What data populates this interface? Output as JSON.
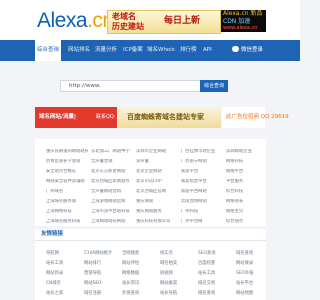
{
  "header": {
    "logo_main": "Alexa",
    "logo_tld": ".cn",
    "promo1": {
      "line1": "老域名",
      "line2": "历史建站",
      "right": "每日上新"
    },
    "promo2": {
      "line1": "Alexa.cn 新品",
      "line2": "CDN 加速",
      "line3": "www.alexa.cn"
    }
  },
  "nav": {
    "items": [
      "综合查询",
      "网站排名",
      "流量分析",
      "ICP备案",
      "域名Whois",
      "排行榜",
      "API"
    ],
    "login": "微信登录"
  },
  "search": {
    "value": "http://www.",
    "button": "综合查询"
  },
  "ads": {
    "red_left": "域名网站/流量|",
    "red_right": "联系QQ: 305...",
    "gold": "百度蜘蛛寄域名建站专家",
    "white": "此广告位招商 QQ 29619"
  },
  "panel": {
    "col1": [
      "重庆长期夜间网站站长",
      "西青区站长学会站",
      "安全站点合格证",
      "网站安全软件及辅助",
      "广州域名",
      "上海域名服务站",
      "上海网络科技",
      "上海域名服务科技"
    ],
    "col2": [
      "东北加工厂网站中小",
      "全声量营销",
      "北京东方新星网站",
      "北京西城区新闻站点",
      "全声量网站营销",
      "上海游戏网站官网",
      "上海市游平台站科技",
      "上海网站站长网站"
    ],
    "col3": [
      "深圳市企业网站",
      "深声量",
      "北京企业网站",
      "北京市店CRP",
      "北京西城区官网",
      "重庆网站",
      "重庆网站服务",
      "重庆科技有限公司"
    ],
    "col4": [
      "广西桂林市站企业",
      "广西南宁网站",
      "家居平台",
      "家居帮营平台",
      "家居平台网站",
      "云南昆明网站",
      "广州科技",
      "广州平台网"
    ],
    "col5": [
      "深圳网站企业",
      "网络科技",
      "网络平台",
      "平台服务",
      "综合科技",
      "网络站长",
      "网络主页",
      "综合站点"
    ]
  },
  "links": {
    "title": "友情链接",
    "col1": [
      "导航网",
      "站长工具",
      "网站目录",
      "CN域名",
      "站长之家"
    ],
    "col2": [
      "51VA网站统计",
      "网站排行",
      "营销导航",
      "网站SEO",
      "域名注册"
    ],
    "col3": [
      "全网搜索",
      "网站评估",
      "网络数据",
      "站长资讯",
      "外链查询"
    ],
    "col4": [
      "找实名",
      "域名拍卖",
      "短视频",
      "网站备案",
      "站长导航"
    ],
    "col5": [
      "SEO查询",
      "百度权重",
      "站长工具",
      "域名交易",
      "域名查询"
    ],
    "col6": [
      "域名查询",
      "网站收录",
      "SEO外链",
      "站长平台",
      "网站地图"
    ]
  }
}
